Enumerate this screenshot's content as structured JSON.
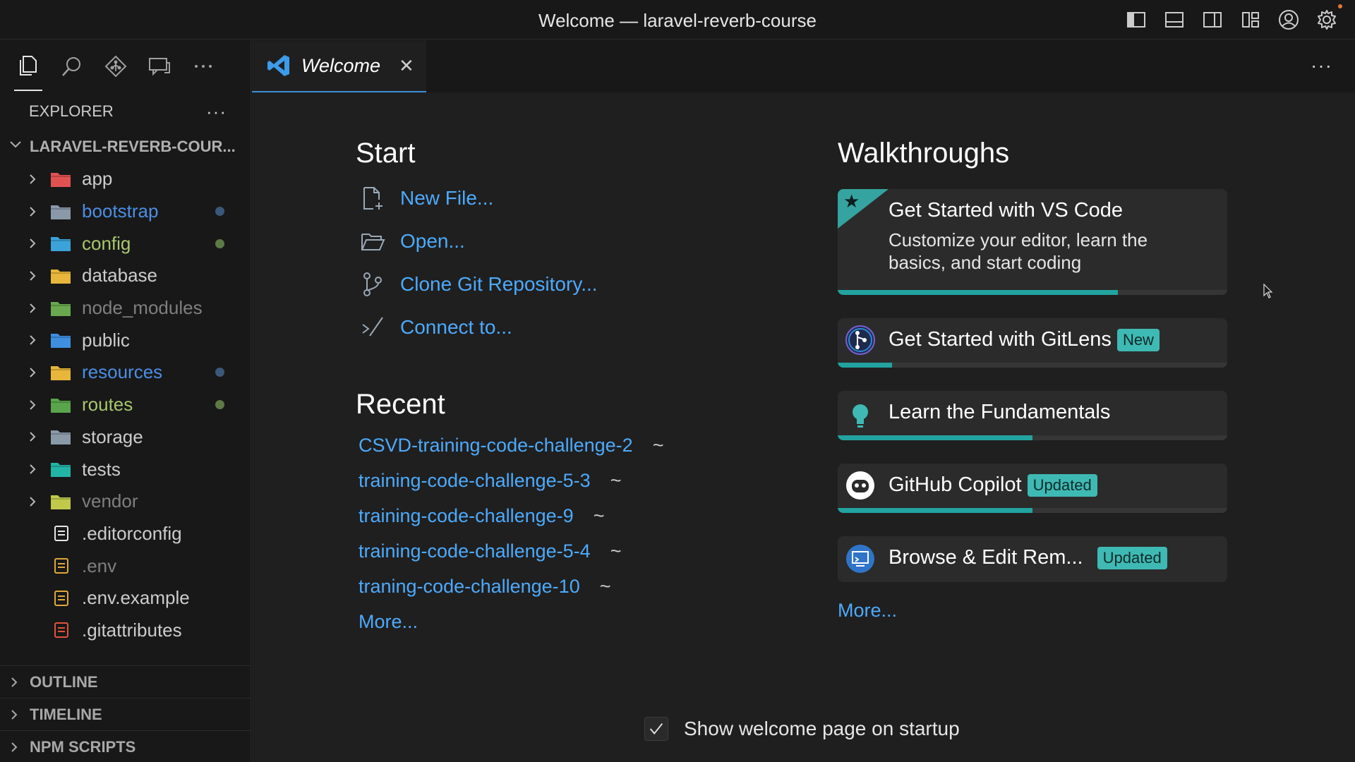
{
  "window": {
    "title": "Welcome — laravel-reverb-course"
  },
  "titlebar_icons": [
    "toggle-primary-sidebar-icon",
    "toggle-panel-icon",
    "toggle-secondary-sidebar-icon",
    "customize-layout-icon",
    "account-icon",
    "manage-gear-icon"
  ],
  "activity_bar": [
    "explorer-icon",
    "search-icon",
    "source-control-icon",
    "chat-icon",
    "more-icon"
  ],
  "explorer": {
    "title": "EXPLORER",
    "more": "···",
    "root": "LARAVEL-REVERB-COUR...",
    "items": [
      {
        "name": "app",
        "kind": "folder",
        "color": "#cccccc",
        "icon_color": "#e05252",
        "dot": null
      },
      {
        "name": "bootstrap",
        "kind": "folder",
        "color": "#4c8ee3",
        "icon_color": "#8a99a8",
        "dot": "#3b587a"
      },
      {
        "name": "config",
        "kind": "folder",
        "color": "#a8c76c",
        "icon_color": "#3ba3d9",
        "dot": "#5e7a44"
      },
      {
        "name": "database",
        "kind": "folder",
        "color": "#cccccc",
        "icon_color": "#e8b63a",
        "dot": null
      },
      {
        "name": "node_modules",
        "kind": "folder",
        "color": "#7f7f7f",
        "icon_color": "#6aa84f",
        "dot": null
      },
      {
        "name": "public",
        "kind": "folder",
        "color": "#cccccc",
        "icon_color": "#3f8fe0",
        "dot": null
      },
      {
        "name": "resources",
        "kind": "folder",
        "color": "#4c8ee3",
        "icon_color": "#e8b63a",
        "dot": "#3b587a"
      },
      {
        "name": "routes",
        "kind": "folder",
        "color": "#a8c76c",
        "icon_color": "#5aa54b",
        "dot": "#5e7a44"
      },
      {
        "name": "storage",
        "kind": "folder",
        "color": "#cccccc",
        "icon_color": "#8a99a8",
        "dot": null
      },
      {
        "name": "tests",
        "kind": "folder",
        "color": "#cccccc",
        "icon_color": "#22b5a6",
        "dot": null
      },
      {
        "name": "vendor",
        "kind": "folder",
        "color": "#7f7f7f",
        "icon_color": "#c0c94a",
        "dot": null
      },
      {
        "name": ".editorconfig",
        "kind": "file",
        "color": "#cccccc",
        "icon_color": "#e6e6e6",
        "dot": null
      },
      {
        "name": ".env",
        "kind": "file",
        "color": "#7f7f7f",
        "icon_color": "#e0a73a",
        "dot": null
      },
      {
        "name": ".env.example",
        "kind": "file",
        "color": "#cccccc",
        "icon_color": "#e0a73a",
        "dot": null
      },
      {
        "name": ".gitattributes",
        "kind": "file",
        "color": "#cccccc",
        "icon_color": "#e0533a",
        "dot": null
      }
    ],
    "sections": [
      "OUTLINE",
      "TIMELINE",
      "NPM SCRIPTS"
    ]
  },
  "tab": {
    "label": "Welcome",
    "close": "✕"
  },
  "editor_more": "···",
  "start": {
    "heading": "Start",
    "items": [
      {
        "label": "New File...",
        "icon": "new-file-icon"
      },
      {
        "label": "Open...",
        "icon": "open-folder-icon"
      },
      {
        "label": "Clone Git Repository...",
        "icon": "git-branch-icon"
      },
      {
        "label": "Connect to...",
        "icon": "remote-connect-icon"
      }
    ]
  },
  "recent": {
    "heading": "Recent",
    "items": [
      {
        "name": "CSVD-training-code-challenge-2",
        "path": "~"
      },
      {
        "name": "training-code-challenge-5-3",
        "path": "~"
      },
      {
        "name": "training-code-challenge-9",
        "path": "~"
      },
      {
        "name": "training-code-challenge-5-4",
        "path": "~"
      },
      {
        "name": "traning-code-challenge-10",
        "path": "~"
      }
    ],
    "more": "More..."
  },
  "walkthroughs": {
    "heading": "Walkthroughs",
    "items": [
      {
        "title": "Get Started with VS Code",
        "description": "Customize your editor, learn the basics, and start coding",
        "progress": 0.72,
        "badge": null
      },
      {
        "title": "Get Started with GitLens",
        "progress": 0.14,
        "badge": "New"
      },
      {
        "title": "Learn the Fundamentals",
        "progress": 0.5,
        "badge": null
      },
      {
        "title": "GitHub Copilot",
        "progress": 0.5,
        "badge": "Updated"
      },
      {
        "title": "Browse & Edit Rem...",
        "progress": 0,
        "badge": "Updated"
      }
    ],
    "more": "More..."
  },
  "startup_checkbox": {
    "label": "Show welcome page on startup",
    "checked": true
  }
}
